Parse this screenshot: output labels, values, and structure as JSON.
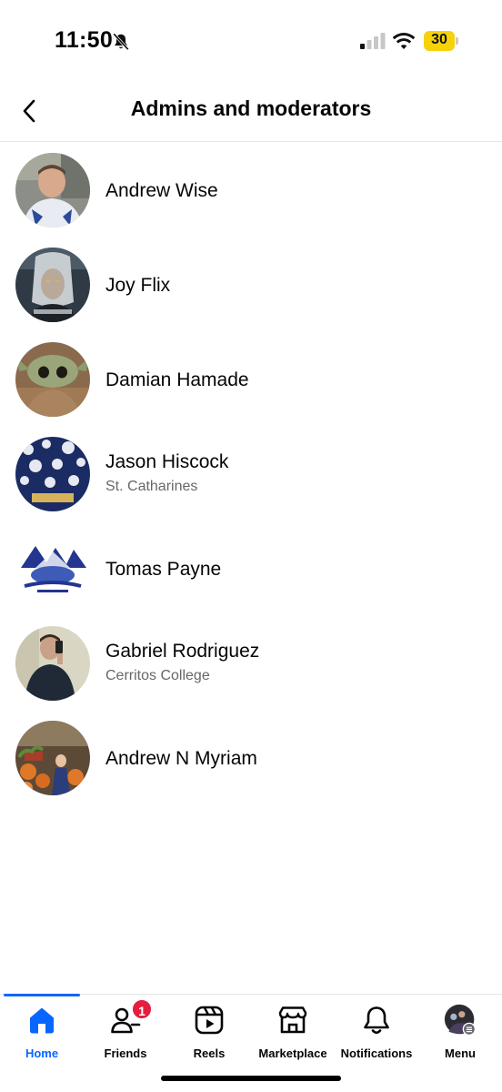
{
  "status_bar": {
    "time": "11:50",
    "battery": "30",
    "icons": [
      "bell-slash-icon",
      "cellular-signal-icon",
      "wifi-icon",
      "battery-icon"
    ]
  },
  "header": {
    "title": "Admins and moderators",
    "back_icon": "chevron-left-icon"
  },
  "members": [
    {
      "name": "Andrew Wise",
      "subtitle": ""
    },
    {
      "name": "Joy Flix",
      "subtitle": ""
    },
    {
      "name": "Damian Hamade",
      "subtitle": ""
    },
    {
      "name": "Jason Hiscock",
      "subtitle": "St. Catharines"
    },
    {
      "name": "Tomas Payne",
      "subtitle": ""
    },
    {
      "name": "Gabriel Rodriguez",
      "subtitle": "Cerritos College"
    },
    {
      "name": "Andrew N Myriam",
      "subtitle": ""
    }
  ],
  "bottom_nav": {
    "items": [
      {
        "label": "Home",
        "icon": "home-icon",
        "active": true
      },
      {
        "label": "Friends",
        "icon": "friends-icon",
        "badge": "1"
      },
      {
        "label": "Reels",
        "icon": "reels-icon"
      },
      {
        "label": "Marketplace",
        "icon": "marketplace-icon"
      },
      {
        "label": "Notifications",
        "icon": "bell-icon"
      },
      {
        "label": "Menu",
        "icon": "profile-avatar-icon"
      }
    ]
  },
  "colors": {
    "accent": "#0866ff",
    "badge": "#e41e3f",
    "secondary_text": "#65676b",
    "battery": "#f5d20a"
  }
}
